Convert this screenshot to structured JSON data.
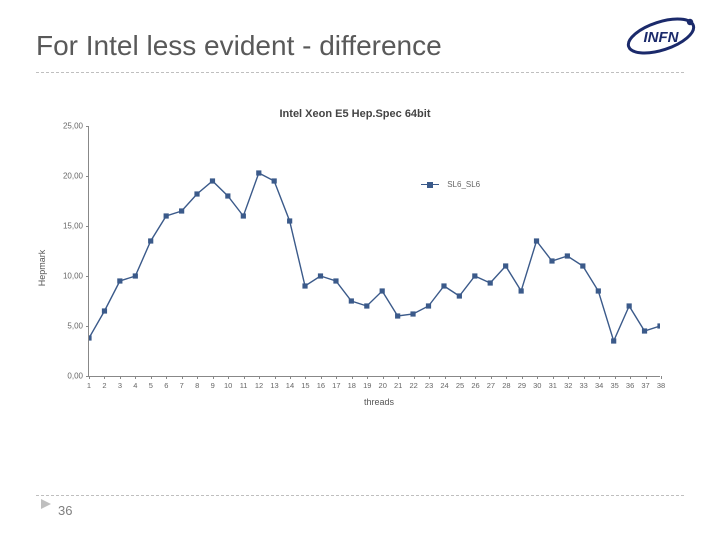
{
  "slide": {
    "title": "For Intel less evident - difference",
    "page_number": "36",
    "logo_text": "INFN"
  },
  "chart_data": {
    "type": "line",
    "title": "Intel Xeon E5  Hep.Spec 64bit",
    "xlabel": "threads",
    "ylabel": "Hepmark",
    "xlim": [
      1,
      38
    ],
    "ylim": [
      0,
      25
    ],
    "yticks": [
      0.0,
      5.0,
      10.0,
      15.0,
      20.0,
      25.0
    ],
    "ytick_labels": [
      "0,00",
      "5,00",
      "10,00",
      "15,00",
      "20,00",
      "25,00"
    ],
    "xticks": [
      1,
      2,
      3,
      4,
      5,
      6,
      7,
      8,
      9,
      10,
      11,
      12,
      13,
      14,
      15,
      16,
      17,
      18,
      19,
      20,
      21,
      22,
      23,
      24,
      25,
      26,
      27,
      28,
      29,
      30,
      31,
      32,
      33,
      34,
      35,
      36,
      37,
      38
    ],
    "series": [
      {
        "name": "SL6_SL6",
        "x": [
          1,
          2,
          3,
          4,
          5,
          6,
          7,
          8,
          9,
          10,
          11,
          12,
          13,
          14,
          15,
          16,
          17,
          18,
          19,
          20,
          21,
          22,
          23,
          24,
          25,
          26,
          27,
          28,
          29,
          30,
          31,
          32,
          33,
          34,
          35,
          36,
          37,
          38
        ],
        "y": [
          3.8,
          6.5,
          9.5,
          10.0,
          13.5,
          16.0,
          16.5,
          18.2,
          19.5,
          18.0,
          16.0,
          20.3,
          19.5,
          15.5,
          9.0,
          10.0,
          9.5,
          7.5,
          7.0,
          8.5,
          6.0,
          6.2,
          7.0,
          9.0,
          8.0,
          10.0,
          9.3,
          11.0,
          8.5,
          13.5,
          11.5,
          12.0,
          11.0,
          8.5,
          3.5,
          7.0,
          4.5,
          5.0
        ]
      }
    ],
    "legend": {
      "position": {
        "x_frac": 0.58,
        "y_frac": 0.2
      }
    },
    "colors": {
      "series0": "#3b5a8a"
    }
  }
}
